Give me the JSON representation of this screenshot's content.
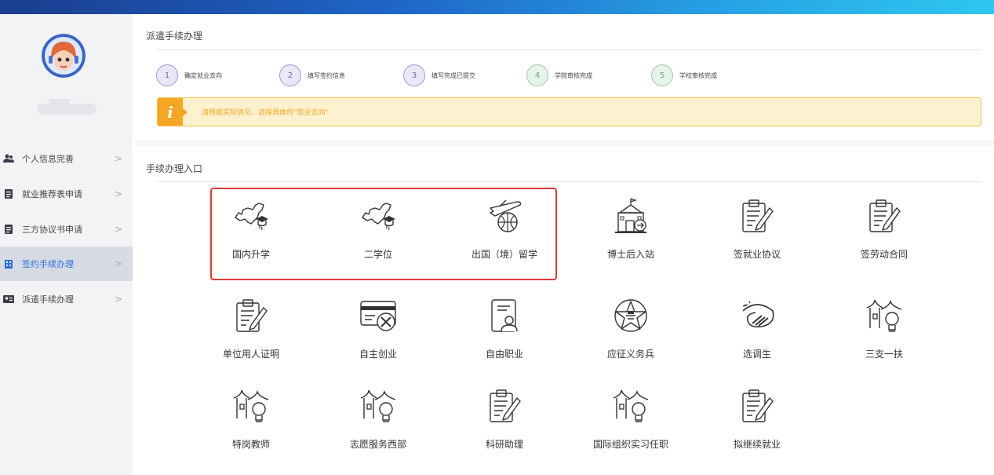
{
  "header": {
    "gradient": [
      "#1a3d8f",
      "#2ec7ef"
    ]
  },
  "sidebar": {
    "items": [
      {
        "label": "个人信息完善",
        "icon": "user-group-icon",
        "active": false
      },
      {
        "label": "就业推荐表申请",
        "icon": "document-icon",
        "active": false
      },
      {
        "label": "三方协议书申请",
        "icon": "document-icon",
        "active": false
      },
      {
        "label": "签约手续办理",
        "icon": "building-icon",
        "active": true
      },
      {
        "label": "派遣手续办理",
        "icon": "id-card-icon",
        "active": false
      }
    ],
    "chevron": ">"
  },
  "dispatch": {
    "title": "派遣手续办理",
    "steps": [
      {
        "num": "1",
        "label": "确定就业去向",
        "state": "current"
      },
      {
        "num": "2",
        "label": "填写签约信息",
        "state": "current"
      },
      {
        "num": "3",
        "label": "填写完成已提交",
        "state": "current"
      },
      {
        "num": "4",
        "label": "学院审核完成",
        "state": "pending"
      },
      {
        "num": "5",
        "label": "学校审核完成",
        "state": "pending"
      }
    ],
    "alert_icon": "i",
    "alert_text": "请根据实际情况，选择具体的“就业去向”"
  },
  "entry": {
    "title": "手续办理入口",
    "tiles": [
      {
        "label": "国内升学",
        "icon": "china-map-graduate-icon"
      },
      {
        "label": "二学位",
        "icon": "china-map-graduate-icon"
      },
      {
        "label": "出国（境）留学",
        "icon": "plane-globe-icon"
      },
      {
        "label": "博士后入站",
        "icon": "school-building-icon"
      },
      {
        "label": "签就业协议",
        "icon": "clipboard-pen-icon"
      },
      {
        "label": "签劳动合同",
        "icon": "clipboard-pen-icon"
      },
      {
        "label": "单位用人证明",
        "icon": "clipboard-pen-icon"
      },
      {
        "label": "自主创业",
        "icon": "card-tools-icon"
      },
      {
        "label": "自由职业",
        "icon": "badge-person-icon"
      },
      {
        "label": "应征义务兵",
        "icon": "army-emblem-icon"
      },
      {
        "label": "选调生",
        "icon": "swirl-emblem-icon"
      },
      {
        "label": "三支一扶",
        "icon": "village-bulb-icon"
      },
      {
        "label": "特岗教师",
        "icon": "village-bulb-icon"
      },
      {
        "label": "志愿服务西部",
        "icon": "village-bulb-icon"
      },
      {
        "label": "科研助理",
        "icon": "clipboard-pen-icon"
      },
      {
        "label": "国际组织实习任职",
        "icon": "village-bulb-icon"
      },
      {
        "label": "拟继续就业",
        "icon": "clipboard-pen-icon"
      }
    ]
  }
}
